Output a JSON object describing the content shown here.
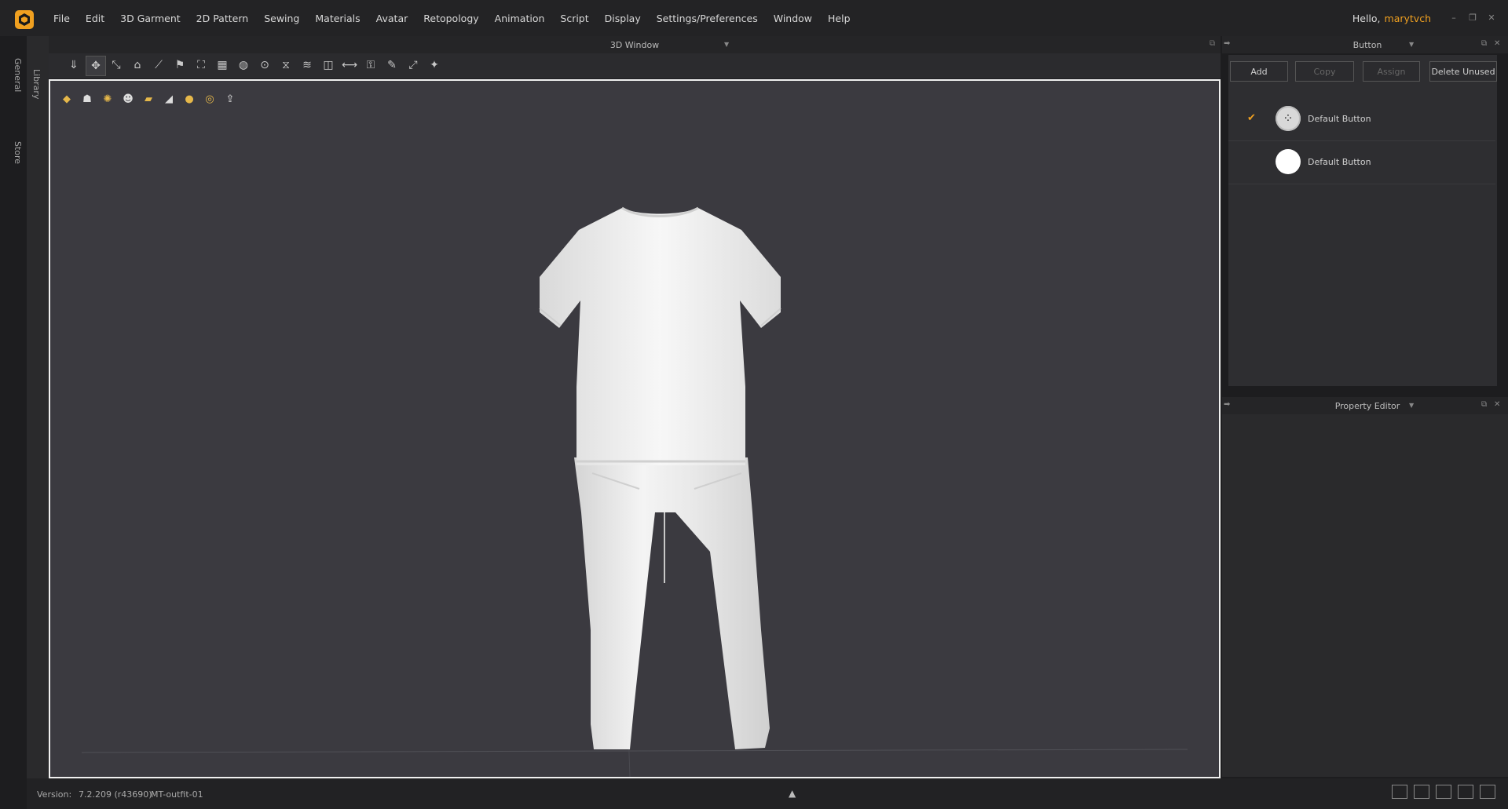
{
  "menu": [
    "File",
    "Edit",
    "3D Garment",
    "2D Pattern",
    "Sewing",
    "Materials",
    "Avatar",
    "Retopology",
    "Animation",
    "Script",
    "Display",
    "Settings/Preferences",
    "Window",
    "Help"
  ],
  "user": {
    "hello": "Hello,",
    "name": "marytvch"
  },
  "left_tabs": {
    "general": "General",
    "library": "Library",
    "store": "Store"
  },
  "window_3d": {
    "title": "3D Window"
  },
  "toolbar_icons": [
    "select-mesh-icon",
    "move-icon",
    "transform-pattern-icon",
    "fold-icon",
    "cut-icon",
    "pin-icon",
    "tack-icon",
    "fabric-icon",
    "button-icon",
    "buttonhole-icon",
    "zipper-icon",
    "puckering-icon",
    "measure-icon",
    "tape-icon",
    "lock-icon",
    "paint-icon",
    "shrink-icon",
    "avatar-measure-icon"
  ],
  "view_icons": [
    "show-garment-icon",
    "show-avatar-icon",
    "texture-icon",
    "avatar-skin-icon",
    "fabric-thickness-icon",
    "pattern-icon",
    "face-icon",
    "globe-icon",
    "upload-icon"
  ],
  "button_panel": {
    "title": "Button",
    "actions": {
      "add": "Add",
      "copy": "Copy",
      "assign": "Assign",
      "delete_unused": "Delete Unused"
    },
    "items": [
      {
        "name": "Default Button",
        "selected": true
      },
      {
        "name": "Default Button",
        "selected": false
      }
    ]
  },
  "property_editor": {
    "title": "Property Editor"
  },
  "status": {
    "version_label": "Version:",
    "version": "7.2.209 (r43690)",
    "project": "MT-outfit-01"
  },
  "colors": {
    "accent": "#f0a020",
    "viewport": "#3b3a40"
  }
}
